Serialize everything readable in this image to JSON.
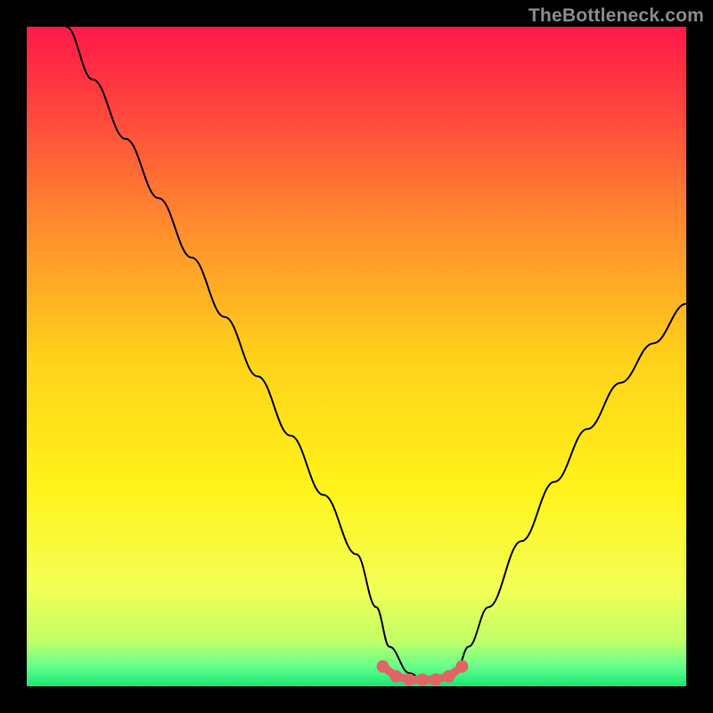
{
  "watermark": "TheBottleneck.com",
  "chart_data": {
    "type": "line",
    "title": "",
    "xlabel": "",
    "ylabel": "",
    "xlim": [
      0,
      100
    ],
    "ylim": [
      0,
      100
    ],
    "grid": false,
    "note": "Background is a vertical red→yellow→green gradient. Black V-shaped curve indicates bottleneck %; minimum (≈0) around x 55–65 with a small plateau drawn as salmon nodes. Values estimated from pixels.",
    "series": [
      {
        "name": "bottleneck-curve",
        "color": "#000000",
        "x": [
          6,
          10,
          15,
          20,
          25,
          30,
          35,
          40,
          45,
          50,
          53,
          55,
          58,
          60,
          62,
          65,
          67,
          70,
          75,
          80,
          85,
          90,
          95,
          100
        ],
        "values": [
          100,
          92,
          83,
          74,
          65,
          56,
          47,
          38,
          29,
          20,
          12,
          6,
          2,
          1,
          1,
          2,
          6,
          12,
          22,
          31,
          39,
          46,
          52,
          58
        ]
      }
    ],
    "plateau_nodes": {
      "color": "#e06666",
      "x": [
        54,
        56,
        58,
        60,
        62,
        64,
        66
      ],
      "values": [
        3,
        1.5,
        1,
        1,
        1,
        1.5,
        3
      ]
    },
    "gradient_stops": [
      {
        "offset": 0.0,
        "color": "#ff1a49"
      },
      {
        "offset": 0.1,
        "color": "#ff3b3f"
      },
      {
        "offset": 0.3,
        "color": "#ff8b2e"
      },
      {
        "offset": 0.5,
        "color": "#ffd11a"
      },
      {
        "offset": 0.7,
        "color": "#fff31a"
      },
      {
        "offset": 0.85,
        "color": "#f4ff55"
      },
      {
        "offset": 0.93,
        "color": "#c3ff66"
      },
      {
        "offset": 0.97,
        "color": "#66ff8c"
      },
      {
        "offset": 1.0,
        "color": "#15e873"
      }
    ]
  }
}
